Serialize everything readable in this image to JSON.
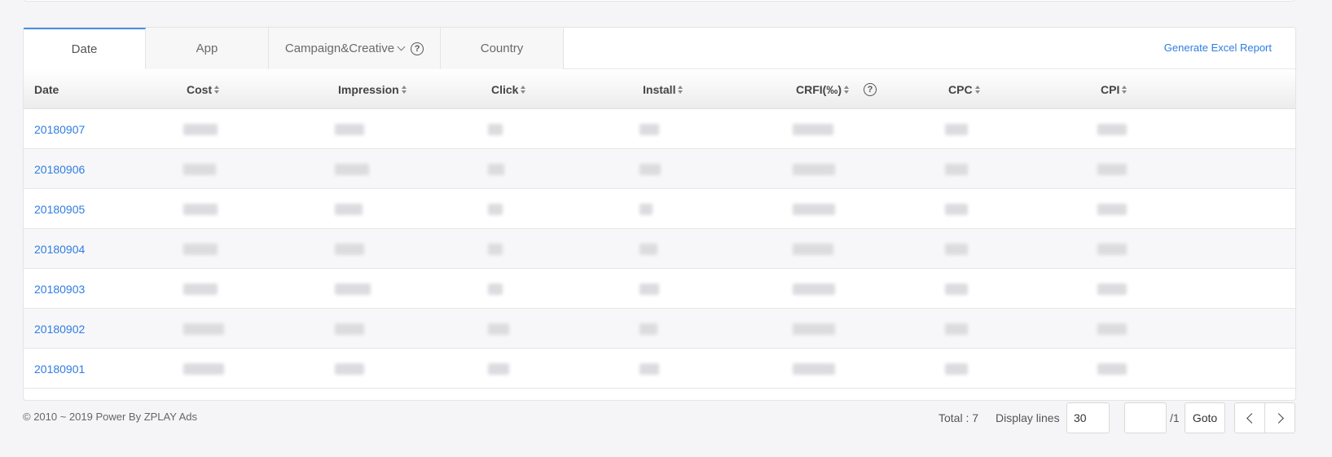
{
  "tabs": [
    {
      "label": "Date"
    },
    {
      "label": "App"
    },
    {
      "label": "Campaign&Creative"
    },
    {
      "label": "Country"
    }
  ],
  "excel_link": "Generate Excel Report",
  "columns": [
    "Date",
    "Cost",
    "Impression",
    "Click",
    "Install",
    "CRFI(‰)",
    "CPC",
    "CPI"
  ],
  "rows": [
    {
      "date": "20180907"
    },
    {
      "date": "20180906"
    },
    {
      "date": "20180905"
    },
    {
      "date": "20180904"
    },
    {
      "date": "20180903"
    },
    {
      "date": "20180902"
    },
    {
      "date": "20180901"
    }
  ],
  "footer": {
    "copyright": "© 2010 ~ 2019 Power By ZPLAY Ads",
    "total": "Total : 7",
    "display_lines_label": "Display lines",
    "display_lines_value": "30",
    "page_total": "/1",
    "goto": "Goto"
  },
  "colors": {
    "accent": "#2f7de1",
    "tab_active_border": "#4a90e2"
  }
}
